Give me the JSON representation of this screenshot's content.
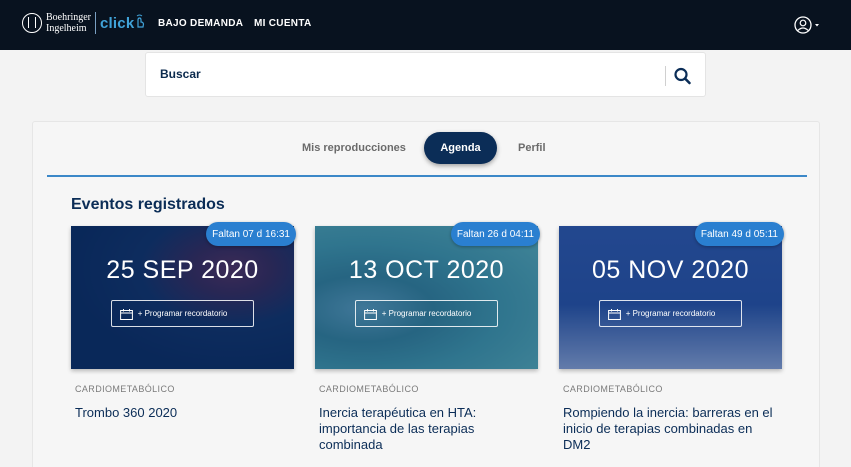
{
  "brand": {
    "company_line1": "Boehringer",
    "company_line2": "Ingelheim",
    "product": "click"
  },
  "nav": {
    "on_demand": "BAJO DEMANDA",
    "my_account": "MI CUENTA",
    "user_icon": "user-circle-icon"
  },
  "search": {
    "placeholder": "Buscar",
    "icon": "search-icon"
  },
  "tabs": {
    "playbacks": "Mis reproducciones",
    "agenda": "Agenda",
    "profile": "Perfil"
  },
  "section": {
    "title": "Eventos registrados"
  },
  "events": [
    {
      "countdown": "Faltan 07 d 16:31",
      "date": "25 SEP 2020",
      "reminder": "+ Programar recordatorio",
      "category": "CARDIOMETABÓLICO",
      "title": "Trombo 360 2020"
    },
    {
      "countdown": "Faltan 26 d 04:11",
      "date": "13 OCT 2020",
      "reminder": "+ Programar recordatorio",
      "category": "CARDIOMETABÓLICO",
      "title": "Inercia terapéutica en HTA: importancia de las terapias combinada"
    },
    {
      "countdown": "Faltan 49 d 05:11",
      "date": "05 NOV 2020",
      "reminder": "+ Programar recordatorio",
      "category": "CARDIOMETABÓLICO",
      "title": "Rompiendo la inercia: barreras en el inicio de terapias combinadas en DM2"
    }
  ],
  "colors": {
    "topbar": "#08121f",
    "brand_navy": "#0b2d57",
    "accent_blue": "#2a7fd0",
    "click_blue": "#40a3d9"
  }
}
